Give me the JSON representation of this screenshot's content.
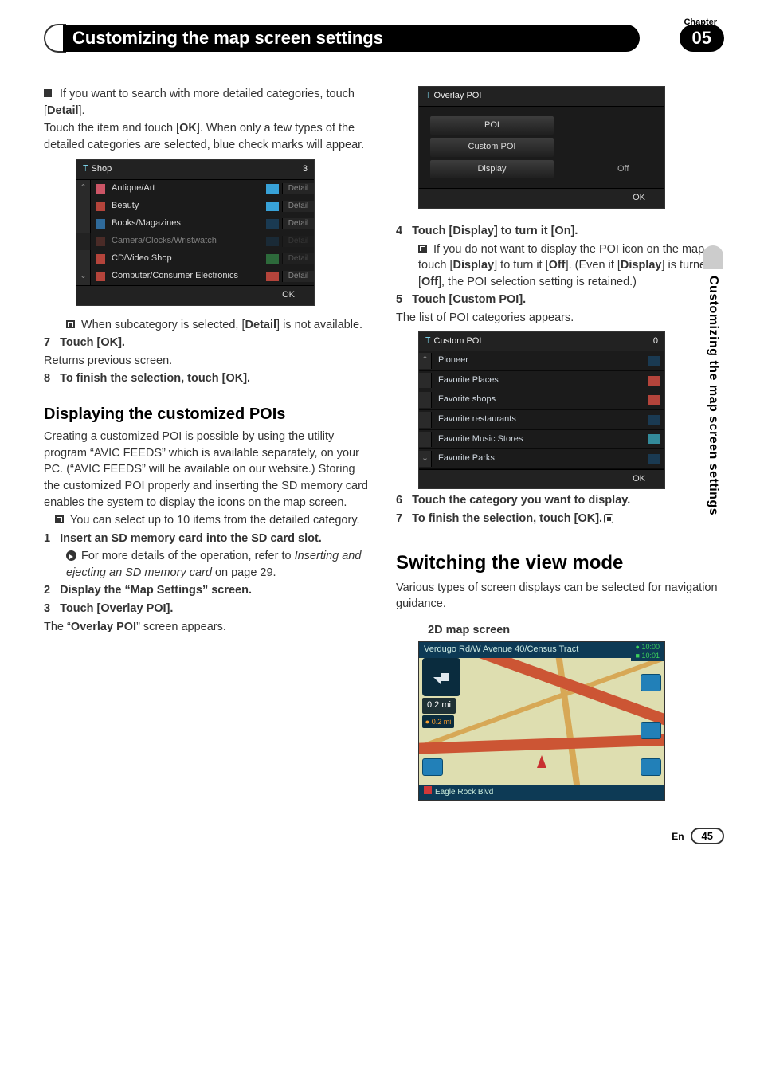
{
  "chapter_label": "Chapter",
  "chapter_num": "05",
  "header_title": "Customizing the map screen settings",
  "vertical_tab": "Customizing the map screen settings",
  "left": {
    "bullet1_a": "If you want to search with more detailed categories, touch [",
    "bullet1_b": "Detail",
    "bullet1_c": "].",
    "touch_a": "Touch the item and touch [",
    "touch_b": "OK",
    "touch_c": "]. When only a few types of the detailed categories are selected, blue check marks will appear.",
    "shop_header": "Shop",
    "shop_count": "3",
    "shop_items": [
      {
        "label": "Antique/Art",
        "icon": "#c56",
        "detail_dim": false,
        "check": "#38a2d8"
      },
      {
        "label": "Beauty",
        "icon": "#b4443b",
        "detail_dim": false,
        "check": "#38a2d8"
      },
      {
        "label": "Books/Magazines",
        "icon": "#2f6a9a",
        "detail_dim": false,
        "check": "#1a3a52"
      },
      {
        "label": "Camera/Clocks/Wristwatch",
        "icon": "#7a3c34",
        "detail_dim": true,
        "check": "#1a3a52",
        "row_dim": true
      },
      {
        "label": "CD/Video Shop",
        "icon": "#b4443b",
        "detail_dim": true,
        "check": "#2d6a3b"
      },
      {
        "label": "Computer/Consumer Electronics",
        "icon": "#b4443b",
        "detail_dim": false,
        "check": "#b4443b"
      }
    ],
    "shop_ok": "OK",
    "detail_label": "Detail",
    "note1_a": "When subcategory is selected, [",
    "note1_b": "Detail",
    "note1_c": "] is not available.",
    "s7": "7",
    "s7_label": "Touch [OK].",
    "s7_desc": "Returns previous screen.",
    "s8": "8",
    "s8_label": "To finish the selection, touch [OK].",
    "h_custom": "Displaying the customized POIs",
    "custom_desc": "Creating a customized POI is possible by using the utility program “AVIC FEEDS” which is available separately, on your PC. (“AVIC FEEDS” will be available on our website.) Storing the customized POI properly and inserting the SD memory card enables the system to display the icons on the map screen.",
    "custom_note": "You can select up to 10 items from the detailed category.",
    "s1": "1",
    "s1_label": "Insert an SD memory card into the SD card slot.",
    "s1_ref_a": "For more details of the operation, refer to ",
    "s1_ref_i": "Inserting and ejecting an SD memory card",
    "s1_ref_b": " on page 29.",
    "s2": "2",
    "s2_label": "Display the “Map Settings” screen.",
    "s3": "3",
    "s3_label": "Touch [Overlay POI].",
    "s3_desc_a": "The “",
    "s3_desc_b": "Overlay POI",
    "s3_desc_c": "” screen appears."
  },
  "right": {
    "overlay_title": "Overlay POI",
    "overlay_poi": "POI",
    "overlay_custom": "Custom POI",
    "overlay_display": "Display",
    "overlay_off": "Off",
    "overlay_ok": "OK",
    "s4": "4",
    "s4_label": "Touch [Display] to turn it [On].",
    "s4_note_a": "If you do not want to display the POI icon on the map, touch [",
    "s4_note_b": "Display",
    "s4_note_c": "] to turn it [",
    "s4_note_d": "Off",
    "s4_note_e": "]. (Even if [",
    "s4_note_f": "Display",
    "s4_note_g": "] is turned [",
    "s4_note_h": "Off",
    "s4_note_i": "], the POI selection setting is retained.)",
    "s5": "5",
    "s5_label": "Touch [Custom POI].",
    "s5_desc": "The list of POI categories appears.",
    "custom_poi_title": "Custom POI",
    "custom_poi_count": "0",
    "custom_items": [
      {
        "label": "Pioneer",
        "c": "#1a3a52"
      },
      {
        "label": "Favorite Places",
        "c": "#b4443b"
      },
      {
        "label": "Favorite shops",
        "c": "#b4443b"
      },
      {
        "label": "Favorite restaurants",
        "c": "#1a3a52"
      },
      {
        "label": "Favorite Music Stores",
        "c": "#338a9a"
      },
      {
        "label": "Favorite Parks",
        "c": "#1a3a52"
      }
    ],
    "custom_ok": "OK",
    "s6": "6",
    "s6_label": "Touch the category you want to display.",
    "s7": "7",
    "s7_label": "To finish the selection, touch [OK].",
    "h_switch": "Switching the view mode",
    "switch_desc": "Various types of screen displays can be selected for navigation guidance.",
    "map_caption": "2D map screen",
    "map_header": "Verdugo Rd/W Avenue 40/Census Tract",
    "map_time1": "● 10:00",
    "map_time2": "■ 10:01",
    "map_dist": "0.2 mi",
    "map_badge": "● 0.2 mi",
    "map_footer": "Eagle Rock Blvd"
  },
  "footer_lang": "En",
  "footer_page": "45"
}
